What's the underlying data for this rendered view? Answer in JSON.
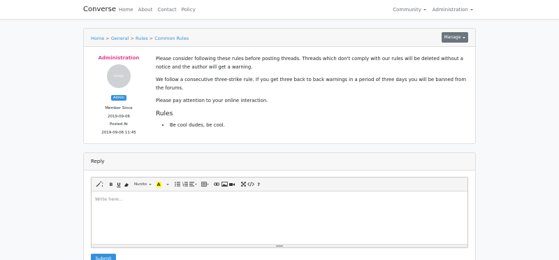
{
  "navbar": {
    "brand": "Converse",
    "links": [
      "Home",
      "About",
      "Contact",
      "Policy"
    ],
    "right_links": [
      "Community",
      "Administration"
    ]
  },
  "breadcrumb": {
    "items": [
      "Home",
      "General",
      "Rules",
      "Common Rules"
    ],
    "separator": ">"
  },
  "manage_button": {
    "label": "Manage"
  },
  "post": {
    "author": "Administration",
    "avatar_text": "Image",
    "role": "Admin",
    "member_since_label": "Member Since",
    "member_since": "2019-09-06",
    "posted_at_label": "Posted At",
    "posted_at": "2019-09-06 11:45",
    "paragraphs": [
      "Please consider following these rules before posting threads. Threads which don't comply with our rules will be deleted without a notice and the author will get a warning.",
      "We follow a consecutive three-strike rule. If you get three back to back warnings in a period of three days you will be banned from the forums.",
      "Please pay attention to your online interaction."
    ],
    "rules_heading": "Rules",
    "rules": [
      "Be cool dudes, be cool."
    ]
  },
  "reply": {
    "title": "Reply",
    "editor": {
      "font_name": "Nunito",
      "placeholder": "Write here...",
      "toolbar_icons": [
        "magic-icon",
        "bold-icon",
        "underline-icon",
        "eraser-icon",
        "font-family-select",
        "text-color-icon",
        "unordered-list-icon",
        "ordered-list-icon",
        "paragraph-align-icon",
        "table-icon",
        "link-icon",
        "picture-icon",
        "video-icon",
        "fullscreen-icon",
        "code-view-icon",
        "help-icon"
      ]
    },
    "submit_label": "Submit"
  },
  "colors": {
    "accent": "#3490dc",
    "author": "#e83e8c",
    "manage": "#6c757d"
  }
}
